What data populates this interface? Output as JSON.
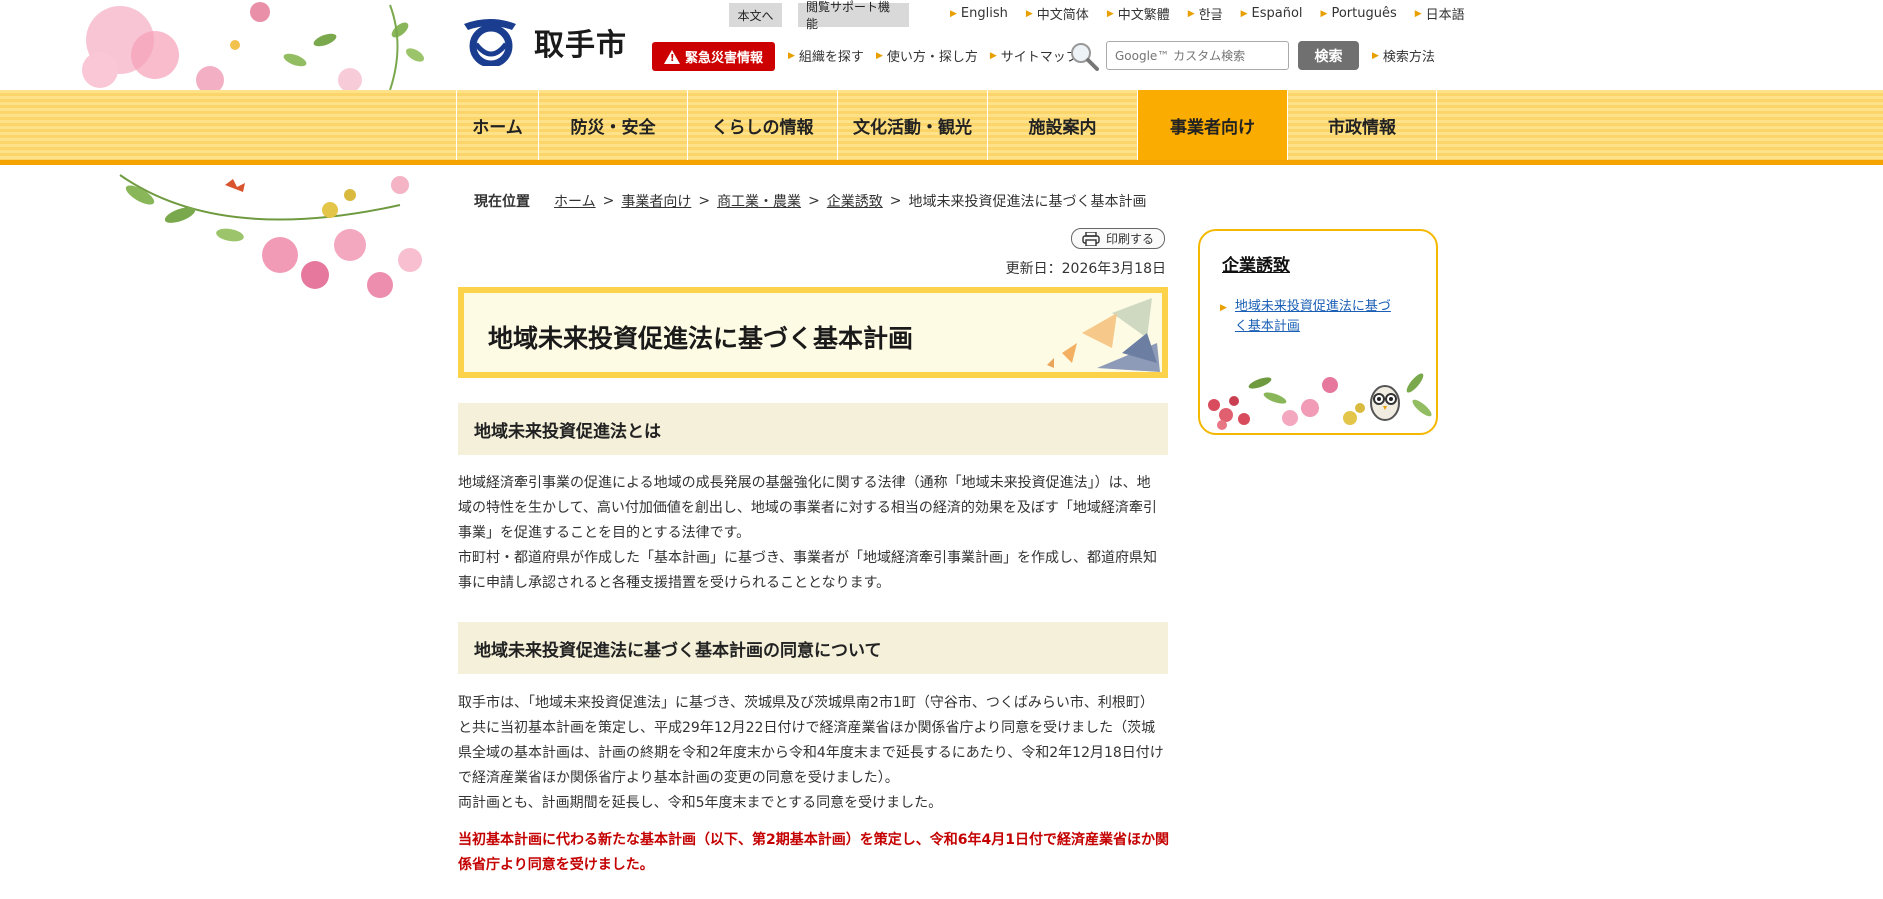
{
  "header": {
    "city_name": "取手市",
    "skip_to_body": "本文へ",
    "accessibility": "閲覧サポート機能",
    "languages": [
      "English",
      "中文简体",
      "中文繁體",
      "한글",
      "Español",
      "Português",
      "日本語"
    ],
    "emergency_label": "緊急災害情報",
    "util_links": [
      "組織を探す",
      "使い方・探し方",
      "サイトマップ"
    ],
    "search": {
      "placeholder": "Google™ カスタム検索",
      "button": "検索",
      "method_link": "検索方法"
    }
  },
  "nav": {
    "items": [
      "ホーム",
      "防災・安全",
      "くらしの情報",
      "文化活動・観光",
      "施設案内",
      "事業者向け",
      "市政情報"
    ],
    "active": "事業者向け"
  },
  "breadcrumb": {
    "label": "現在位置",
    "links": [
      "ホーム",
      "事業者向け",
      "商工業・農業",
      "企業誘致"
    ],
    "current": "地域未来投資促進法に基づく基本計画"
  },
  "page": {
    "print_label": "印刷する",
    "updated": "更新日：2026年3月18日",
    "title": "地域未来投資促進法に基づく基本計画",
    "sections": [
      {
        "heading": "地域未来投資促進法とは",
        "lines": [
          "地域経済牽引事業の促進による地域の成長発展の基盤強化に関する法律（通称「地域未来投資促進法」）は、地",
          "域の特性を生かして、高い付加価値を創出し、地域の事業者に対する相当の経済的効果を及ぼす「地域経済牽引",
          "事業」を促進することを目的とする法律です。",
          "市町村・都道府県が作成した「基本計画」に基づき、事業者が「地域経済牽引事業計画」を作成し、都道府県知",
          "事に申請し承認されると各種支援措置を受けられることとなります。"
        ]
      },
      {
        "heading": "地域未来投資促進法に基づく基本計画の同意について",
        "lines": [
          "取手市は、「地域未来投資促進法」に基づき、茨城県及び茨城県南2市1町（守谷市、つくばみらい市、利根町）",
          "と共に当初基本計画を策定し、平成29年12月22日付けで経済産業省ほか関係省庁より同意を受けました（茨城",
          "県全域の基本計画は、計画の終期を令和2年度末から令和4年度末まで延長するにあたり、令和2年12月18日付け",
          "で経済産業省ほか関係省庁より基本計画の変更の同意を受けました）。",
          "両計画とも、計画期間を延長し、令和5年度末までとする同意を受けました。"
        ],
        "red_lines": [
          "当初基本計画に代わる新たな基本計画（以下、第2期基本計画）を策定し、令和6年4月1日付で経済産業省ほか関",
          "係省庁より同意を受けました。"
        ]
      }
    ]
  },
  "sidebar": {
    "title": "企業誘致",
    "links": [
      "地域未来投資促進法に基づ",
      "く基本計画"
    ]
  },
  "colors": {
    "nav_yellow": "#fde289",
    "nav_active": "#fbac00",
    "emergency_red": "#cc0000",
    "section_bg": "#f4f0d9",
    "title_border": "#fcd24a",
    "link_blue": "#1a5fb4",
    "alert_red": "#c40000"
  },
  "icons": [
    "city-logo-icon",
    "warning-icon",
    "search-magnifier-icon",
    "printer-icon",
    "triangle-bullet-icon"
  ]
}
